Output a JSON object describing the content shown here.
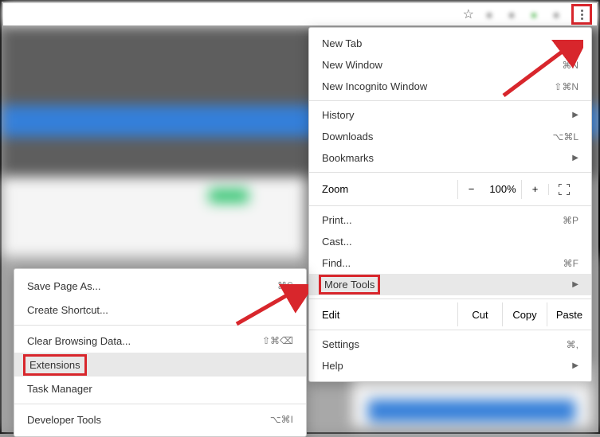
{
  "toolbar": {
    "star_icon": "☆",
    "menu_button": "⋮"
  },
  "menu": {
    "new_tab": "New Tab",
    "new_window": "New Window",
    "new_window_shortcut": "⌘N",
    "new_incognito": "New Incognito Window",
    "new_incognito_shortcut": "⇧⌘N",
    "history": "History",
    "downloads": "Downloads",
    "downloads_shortcut": "⌥⌘L",
    "bookmarks": "Bookmarks",
    "zoom_label": "Zoom",
    "zoom_minus": "−",
    "zoom_value": "100%",
    "zoom_plus": "+",
    "print": "Print...",
    "print_shortcut": "⌘P",
    "cast": "Cast...",
    "find": "Find...",
    "find_shortcut": "⌘F",
    "more_tools": "More Tools",
    "edit": "Edit",
    "cut": "Cut",
    "copy": "Copy",
    "paste": "Paste",
    "settings": "Settings",
    "settings_shortcut": "⌘,",
    "help": "Help"
  },
  "submenu": {
    "save_page": "Save Page As...",
    "save_page_shortcut": "⌘S",
    "create_shortcut": "Create Shortcut...",
    "clear_browsing": "Clear Browsing Data...",
    "clear_browsing_shortcut": "⇧⌘⌫",
    "extensions": "Extensions",
    "task_manager": "Task Manager",
    "developer_tools": "Developer Tools",
    "developer_tools_shortcut": "⌥⌘I"
  },
  "annotations": {
    "highlight_color": "#d8262c"
  }
}
